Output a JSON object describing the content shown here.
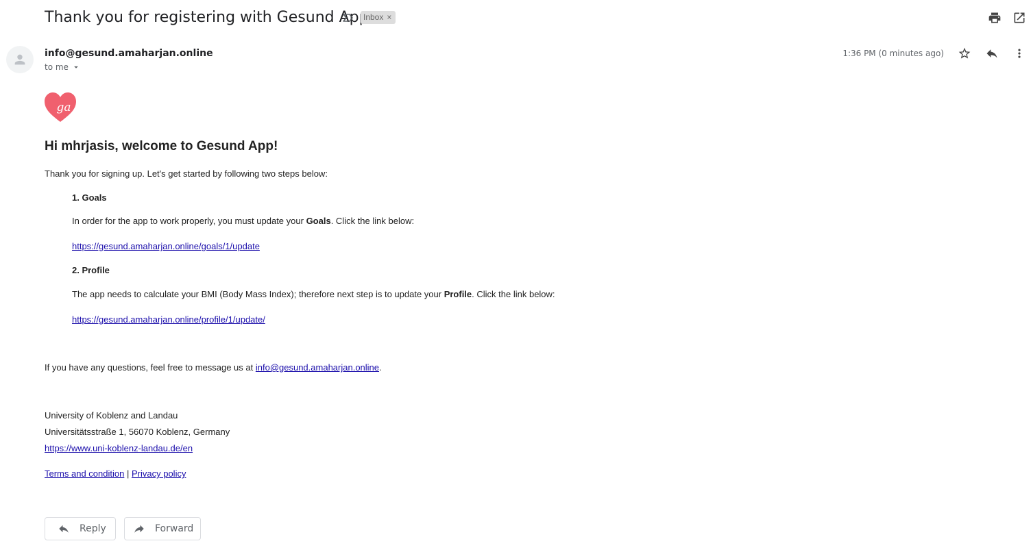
{
  "header": {
    "subject": "Thank you for registering with Gesund App",
    "label_chip": "Inbox",
    "label_remove": "×",
    "icons": [
      "important-marker-icon",
      "print-icon",
      "open-in-new-window-icon"
    ]
  },
  "message": {
    "sender": "info@gesund.amaharjan.online",
    "recipient_label": "to me",
    "time": "1:36 PM (0 minutes ago)",
    "icons": [
      "avatar-person-icon",
      "star-icon",
      "reply-icon",
      "more-vert-icon",
      "chevron-down-icon"
    ]
  },
  "body": {
    "logo_text": "ga",
    "welcome": "Hi mhrjasis, welcome to Gesund App!",
    "intro": "Thank you for signing up. Let's get started by following two steps below:",
    "step1_title": "1. Goals",
    "step1_pre": "In order for the app to work properly, you must update your ",
    "step1_bold": "Goals",
    "step1_post": ". Click the link below:",
    "step1_link": "https://gesund.amaharjan.online/goals/1/update",
    "step2_title": "2. Profile",
    "step2_pre": "The app needs to calculate your BMI (Body Mass Index); therefore next step is to update your ",
    "step2_bold": "Profile",
    "step2_post": ". Click the link below:",
    "step2_link": "https://gesund.amaharjan.online/profile/1/update/",
    "questions_pre": "If you have any questions, feel free to message us at ",
    "questions_link": "info@gesund.amaharjan.online",
    "questions_post": ".",
    "org_name": "University of Koblenz and Landau",
    "org_address": "Universitätsstraße 1, 56070 Koblenz, Germany",
    "org_link": "https://www.uni-koblenz-landau.de/en",
    "terms_link": "Terms and condition",
    "separator": "|",
    "privacy_link": "Privacy policy"
  },
  "actions": {
    "reply_label": "Reply",
    "forward_label": "Forward"
  },
  "colors": {
    "link": "#1a0dab",
    "logo_heart": "#f0606e",
    "chip_bg": "#dddddd"
  }
}
